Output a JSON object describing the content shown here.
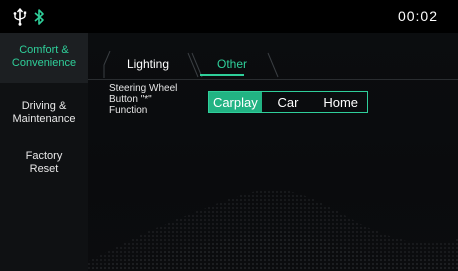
{
  "statusbar": {
    "icons": [
      "usb-icon",
      "bluetooth-icon"
    ],
    "time": "00:02"
  },
  "sidebar": {
    "items": [
      {
        "line1": "Comfort &",
        "line2": "Convenience",
        "active": true
      },
      {
        "line1": "Driving &",
        "line2": "Maintenance",
        "active": false
      },
      {
        "line1": "Factory",
        "line2": "Reset",
        "active": false
      }
    ]
  },
  "main": {
    "tabs": [
      {
        "label": "Lighting",
        "active": false
      },
      {
        "label": "Other",
        "active": true
      }
    ],
    "setting": {
      "label_line1": "Steering Wheel",
      "label_line2": "Button \"*\"",
      "label_line3": "Function",
      "options": [
        "Carplay",
        "Car",
        "Home"
      ],
      "selected": "Carplay"
    }
  },
  "colors": {
    "accent": "#2fcf9a",
    "accent_fill": "#22b383",
    "sidebar_bg": "#0f1113",
    "sidebar_active_bg": "#1c1f22"
  }
}
